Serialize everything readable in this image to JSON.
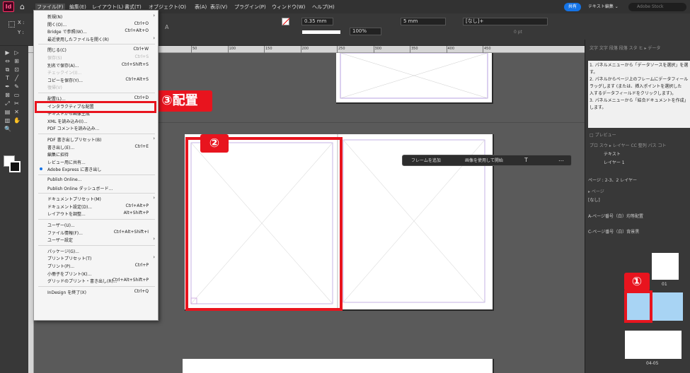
{
  "app": {
    "logo": "Id"
  },
  "menubar": {
    "items": [
      "ファイル(F)",
      "編集(E)",
      "レイアウト(L)",
      "書式(T)",
      "オブジェクト(O)",
      "表(A)",
      "表示(V)",
      "プラグイン(P)",
      "ウィンドウ(W)",
      "ヘルプ(H)"
    ],
    "share": "共有",
    "workspace": "テキスト編集 ⌄",
    "search_placeholder": "Adobe Stock"
  },
  "control": {
    "x_label": "X :",
    "y_label": "Y :",
    "stroke": "0.35 mm",
    "gap": "5 mm",
    "zoom": "100%",
    "style": "[なし]+",
    "pt": "0 pt",
    "label_a": "A"
  },
  "ruler": {
    "ticks": [
      "50",
      "100",
      "150",
      "200",
      "250",
      "300",
      "350",
      "400",
      "450"
    ]
  },
  "menu": {
    "rows": [
      {
        "label": "新規(N)",
        "shortcut": "",
        "arrow": true,
        "dis": false
      },
      {
        "label": "開く(O)...",
        "shortcut": "Ctrl+O",
        "arrow": false,
        "dis": false
      },
      {
        "label": "Bridge で参照(W)...",
        "shortcut": "Ctrl+Alt+O",
        "arrow": false,
        "dis": false
      },
      {
        "label": "最近使用したファイルを開く(R)",
        "shortcut": "",
        "arrow": true,
        "dis": false
      },
      {
        "sep": true
      },
      {
        "label": "閉じる(C)",
        "shortcut": "Ctrl+W",
        "arrow": false,
        "dis": false
      },
      {
        "label": "保存(S)",
        "shortcut": "Ctrl+S",
        "arrow": false,
        "dis": true
      },
      {
        "label": "別名で保存(A)...",
        "shortcut": "Ctrl+Shift+S",
        "arrow": false,
        "dis": false
      },
      {
        "label": "チェックイン(I)...",
        "shortcut": "",
        "arrow": false,
        "dis": true
      },
      {
        "label": "コピーを保存(Y)...",
        "shortcut": "Ctrl+Alt+S",
        "arrow": false,
        "dis": false
      },
      {
        "label": "復帰(V)",
        "shortcut": "",
        "arrow": false,
        "dis": true
      },
      {
        "sep": true
      },
      {
        "label": "配置(L)...",
        "shortcut": "Ctrl+D",
        "arrow": false,
        "dis": false
      },
      {
        "label": "インタラクティブな配置",
        "shortcut": "",
        "arrow": false,
        "dis": false
      },
      {
        "label": "テキストから画像生成",
        "shortcut": "",
        "arrow": false,
        "dis": false
      },
      {
        "label": "XML を読み込み(I)...",
        "shortcut": "",
        "arrow": false,
        "dis": false
      },
      {
        "label": "PDF コメントを読み込み...",
        "shortcut": "",
        "arrow": false,
        "dis": false
      },
      {
        "sep": true
      },
      {
        "label": "PDF 書き出しプリセット(B)",
        "shortcut": "",
        "arrow": true,
        "dis": false
      },
      {
        "label": "書き出し(E)...",
        "shortcut": "Ctrl+E",
        "arrow": false,
        "dis": false
      },
      {
        "label": "編集に招待",
        "shortcut": "",
        "arrow": false,
        "dis": false
      },
      {
        "label": "レビュー用に共有...",
        "shortcut": "",
        "arrow": false,
        "dis": false
      },
      {
        "label": "Adobe Express に書き出し",
        "shortcut": "",
        "arrow": false,
        "dis": false,
        "dot": true
      },
      {
        "sep": true
      },
      {
        "label": "Publish Online...",
        "shortcut": "",
        "arrow": false,
        "dis": false
      },
      {
        "label": "Publish Online ダッシュボード...",
        "shortcut": "",
        "arrow": false,
        "dis": false
      },
      {
        "sep": true
      },
      {
        "label": "ドキュメントプリセット(M)",
        "shortcut": "",
        "arrow": true,
        "dis": false
      },
      {
        "label": "ドキュメント設定(D)...",
        "shortcut": "Ctrl+Alt+P",
        "arrow": false,
        "dis": false
      },
      {
        "label": "レイアウトを調整...",
        "shortcut": "Alt+Shift+P",
        "arrow": false,
        "dis": false
      },
      {
        "sep": true
      },
      {
        "label": "ユーザー(U)...",
        "shortcut": "",
        "arrow": false,
        "dis": false
      },
      {
        "label": "ファイル情報(F)...",
        "shortcut": "Ctrl+Alt+Shift+I",
        "arrow": false,
        "dis": false
      },
      {
        "label": "ユーザー設定",
        "shortcut": "",
        "arrow": true,
        "dis": false
      },
      {
        "sep": true
      },
      {
        "label": "パッケージ(G)...",
        "shortcut": "",
        "arrow": false,
        "dis": false
      },
      {
        "label": "プリントプリセット(T)",
        "shortcut": "",
        "arrow": true,
        "dis": false
      },
      {
        "label": "プリント(P)...",
        "shortcut": "Ctrl+P",
        "arrow": false,
        "dis": false
      },
      {
        "label": "小冊子をプリント(K)...",
        "shortcut": "",
        "arrow": false,
        "dis": false
      },
      {
        "label": "グリッドのプリント・書き出し(R)...",
        "shortcut": "Ctrl+Alt+Shift+P",
        "arrow": false,
        "dis": false
      },
      {
        "sep": true
      },
      {
        "label": "InDesign を終了(X)",
        "shortcut": "Ctrl+Q",
        "arrow": false,
        "dis": false
      }
    ]
  },
  "annotations": {
    "step1": "①",
    "step2": "②",
    "step3": "③配置"
  },
  "taskbar": {
    "add_frame": "フレームを追加",
    "gen_image": "画像を使用して開始"
  },
  "rpanel": {
    "tabs": "文字 文字 段落 段落 スタ ヒ ▸ データ",
    "help": [
      "1. パネルメニューから「データソースを選択」を選",
      "す。",
      "2. パネルからページ上のフレームにデータフィール",
      "ラッグします (または、挿入ポイントを選択した",
      "入するデータフィールドをクリックします)。",
      "3. パネルメニューから「結合ドキュメントを作成」",
      "します。"
    ],
    "preview": "□ プレビュー",
    "layer_tabs": "プロ スウ ▸ レイヤー CC 整列 パス コト",
    "layers": [
      "テキスト",
      "レイヤー 1"
    ],
    "page_info": "ページ : 2-3、2 レイヤー",
    "pages_tab": "▸ ページ",
    "none": "[なし]",
    "masterA": "A-ページ番号（白）均等配置",
    "masterC": "C-ページ番号（白）背景黒",
    "p01": "01",
    "p0405": "04-05"
  }
}
